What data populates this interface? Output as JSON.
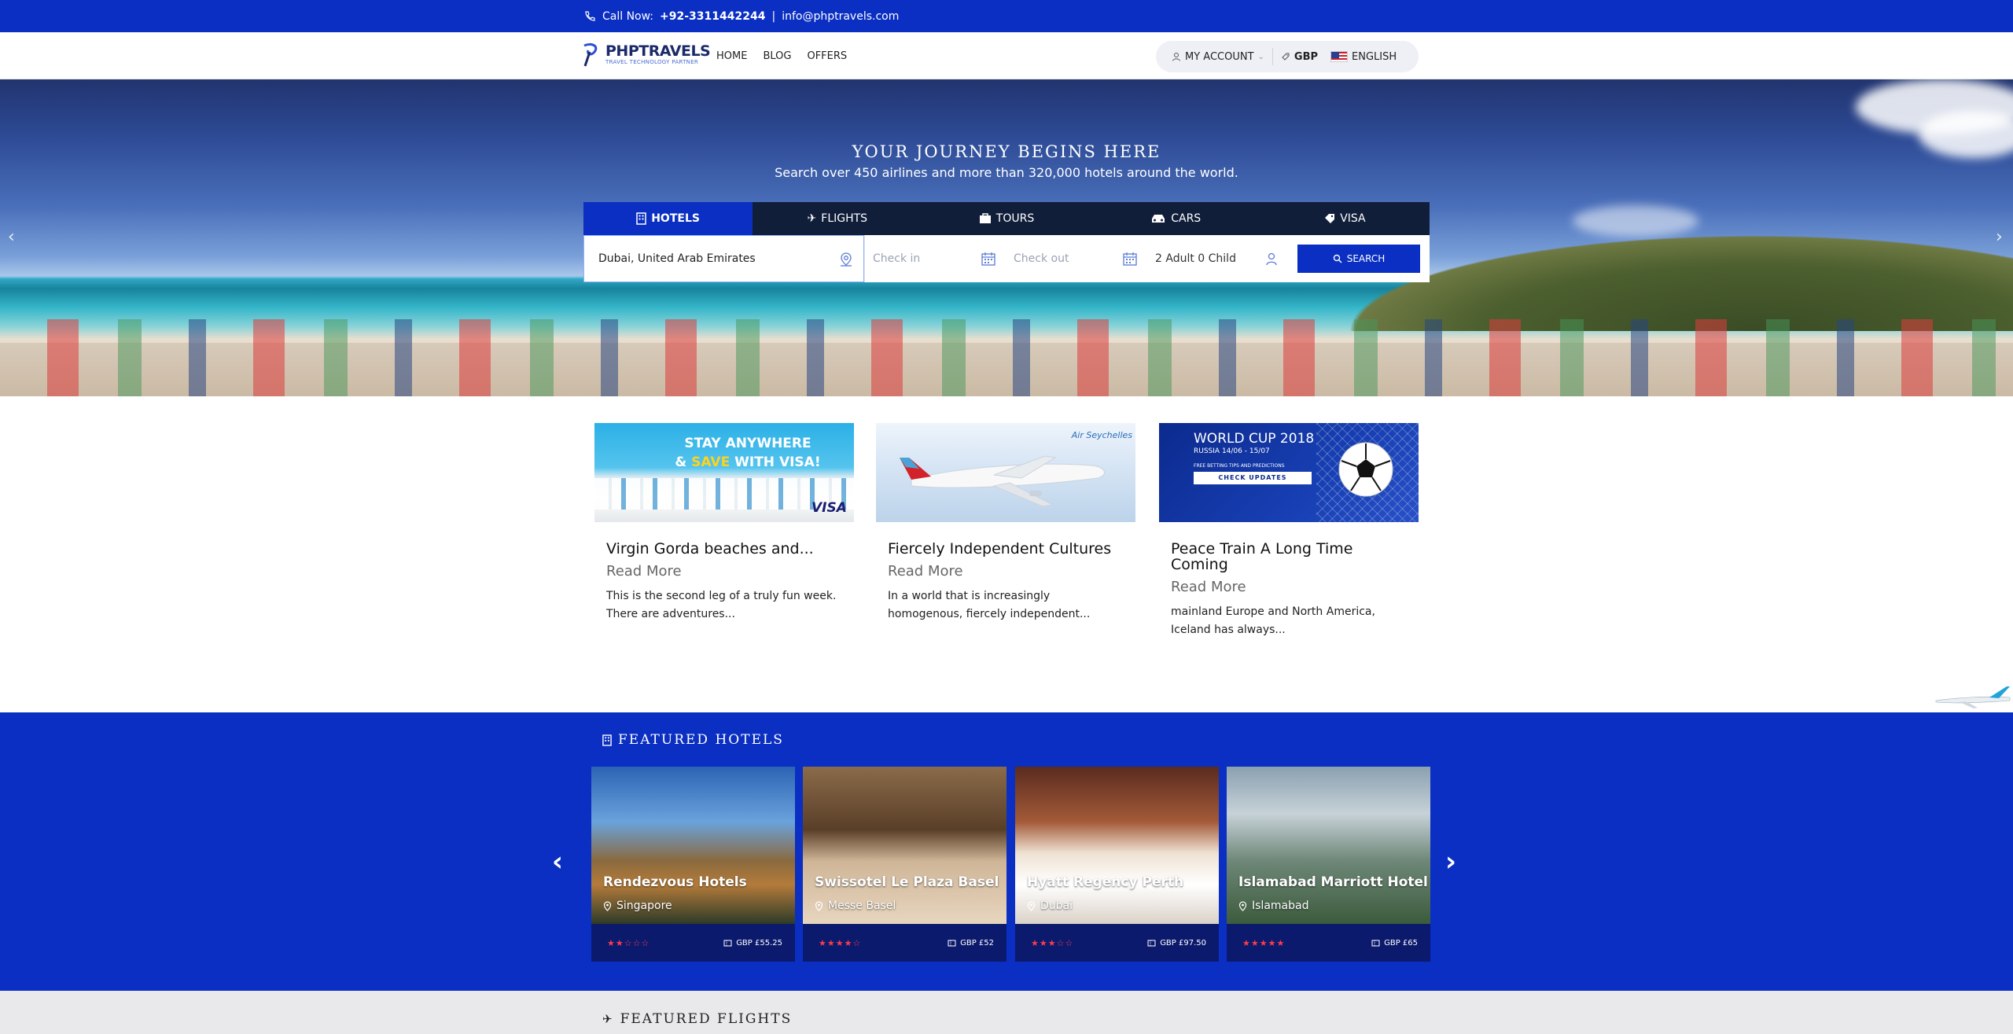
{
  "topbar": {
    "call_label": "Call Now:",
    "phone": "+92-3311442244",
    "separator": "|",
    "email": "info@phptravels.com"
  },
  "header": {
    "logo_name": "PHPTRAVELS",
    "logo_tagline": "TRAVEL TECHNOLOGY PARTNER",
    "nav": [
      "HOME",
      "BLOG",
      "OFFERS"
    ],
    "account_label": "MY ACCOUNT",
    "currency": "GBP",
    "language": "ENGLISH"
  },
  "hero": {
    "headline": "YOUR JOURNEY BEGINS HERE",
    "subline": "Search over 450 airlines and more than 320,000 hotels around the world."
  },
  "search": {
    "tabs": [
      "HOTELS",
      "FLIGHTS",
      "TOURS",
      "CARS",
      "VISA"
    ],
    "active_tab": "HOTELS",
    "destination_value": "Dubai, United Arab Emirates",
    "checkin_placeholder": "Check in",
    "checkout_placeholder": "Check out",
    "guests_value": "2 Adult 0 Child",
    "button_label": "SEARCH"
  },
  "blog": {
    "cards": [
      {
        "banner_line1": "STAY ANYWHERE",
        "banner_line2_pre": "& ",
        "banner_line2_hl": "SAVE",
        "banner_line2_post": " WITH VISA!",
        "banner_brand": "VISA",
        "title": "Virgin Gorda beaches and...",
        "read_more": "Read More",
        "excerpt": "This is the second leg of a truly fun week. There are adventures..."
      },
      {
        "banner_brand": "Air Seychelles",
        "title": "Fiercely Independent Cultures",
        "read_more": "Read More",
        "excerpt": "In a world that is increasingly homogenous, fiercely independent..."
      },
      {
        "banner_line1": "WORLD CUP 2018",
        "banner_line2": "RUSSIA 14/06 - 15/07",
        "banner_line3": "FREE BETTING TIPS AND PREDICTIONS",
        "banner_button": "CHECK UPDATES",
        "title": "Peace Train A Long Time Coming",
        "read_more": "Read More",
        "excerpt": " mainland Europe and North America, Iceland has always..."
      }
    ]
  },
  "featured_hotels": {
    "heading": "FEATURED HOTELS",
    "hotels": [
      {
        "name": "Rendezvous Hotels",
        "location": "Singapore",
        "rating": 2,
        "price": "GBP £55.25"
      },
      {
        "name": "Swissotel Le Plaza Basel",
        "location": "Messe Basel",
        "rating": 4,
        "price": "GBP £52"
      },
      {
        "name": "Hyatt Regency Perth",
        "location": "Dubai",
        "rating": 3,
        "price": "GBP £97.50"
      },
      {
        "name": "Islamabad Marriott Hotel",
        "location": "Islamabad",
        "rating": 5,
        "price": "GBP £65"
      }
    ]
  },
  "featured_flights": {
    "heading": "FEATURED FLIGHTS"
  },
  "colors": {
    "brand_blue": "#0a2fc2",
    "dark_navy": "#111e3a",
    "star_red": "#ff3b4a"
  },
  "icons": [
    "phone-icon",
    "logo-icon",
    "user-icon",
    "currency-icon",
    "flag-icon",
    "hotel-icon",
    "plane-icon",
    "briefcase-icon",
    "car-icon",
    "tag-icon",
    "location-icon",
    "calendar-icon",
    "search-icon",
    "chevron-left-icon",
    "chevron-right-icon",
    "pin-icon",
    "ticket-icon"
  ]
}
